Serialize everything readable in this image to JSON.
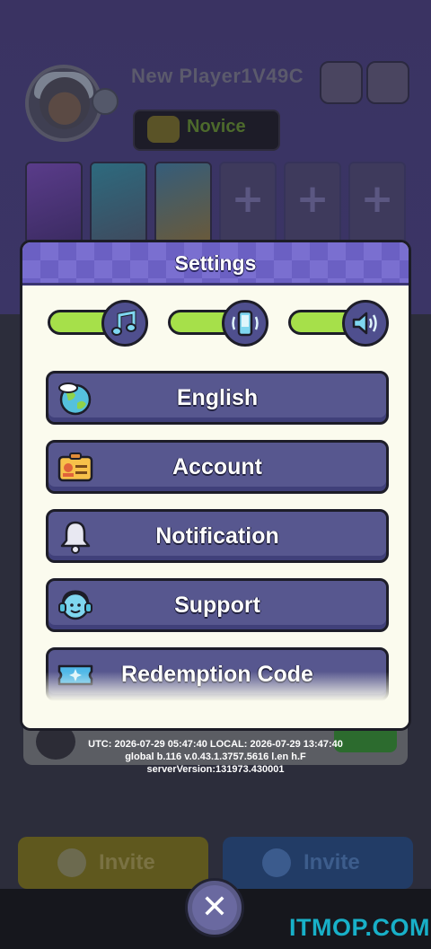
{
  "background": {
    "player_name": "New Player1V49C",
    "rank_label": "Novice",
    "invite_left_label": "Invite",
    "invite_right_label": "Invite"
  },
  "settings": {
    "title": "Settings",
    "toggles": [
      {
        "name": "music",
        "icon": "music-note-icon",
        "on": true
      },
      {
        "name": "vibration",
        "icon": "phone-vibrate-icon",
        "on": true
      },
      {
        "name": "sound",
        "icon": "speaker-icon",
        "on": true
      }
    ],
    "menu": [
      {
        "label": "English",
        "icon": "globe-icon"
      },
      {
        "label": "Account",
        "icon": "id-card-icon"
      },
      {
        "label": "Notification",
        "icon": "bell-icon"
      },
      {
        "label": "Support",
        "icon": "headset-icon"
      },
      {
        "label": "Redemption Code",
        "icon": "ticket-icon"
      }
    ]
  },
  "debug": {
    "line1": "UTC: 2026-07-29 05:47:40 LOCAL: 2026-07-29 13:47:40",
    "line2": "global b.116 v.0.43.1.3757.5616 l.en h.F",
    "line3": "serverVersion:131973.430001"
  },
  "close_label": "✕",
  "watermark": "ITMOP.COM",
  "colors": {
    "toggle_on": "#a6e04a",
    "button": "#57578f",
    "header": "#7a6fd0",
    "panel": "#fbfbee"
  }
}
